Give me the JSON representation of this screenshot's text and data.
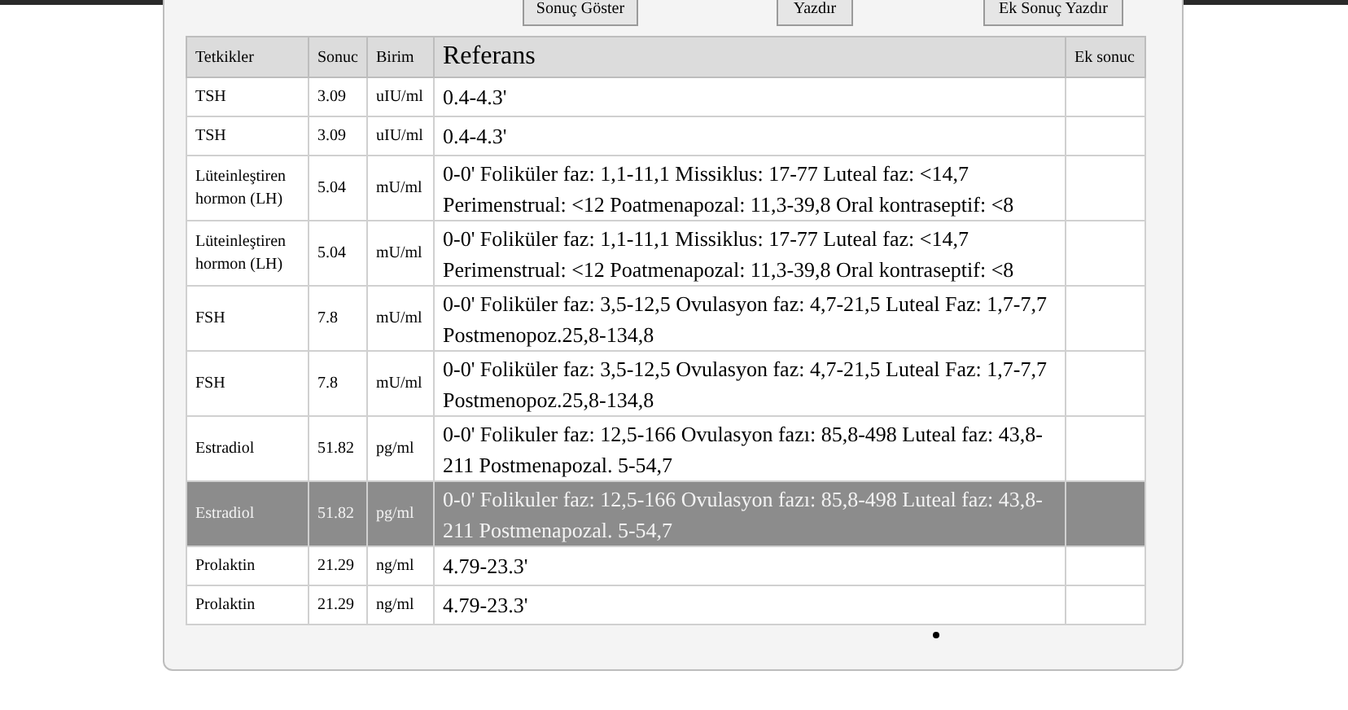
{
  "buttons": [
    "Sonuç Göster",
    "Yazdır",
    "Ek Sonuç Yazdır"
  ],
  "table": {
    "columns": [
      "Tetkikler",
      "Sonuc",
      "Birim",
      "Referans",
      "Ek sonuc"
    ],
    "rows": [
      {
        "test": "TSH",
        "result": "3.09",
        "unit": "uIU/ml",
        "reference": "0.4-4.3'",
        "selected": false
      },
      {
        "test": "TSH",
        "result": "3.09",
        "unit": "uIU/ml",
        "reference": "0.4-4.3'",
        "selected": false
      },
      {
        "test": "Lüteinleştiren hormon (LH)",
        "result": "5.04",
        "unit": "mU/ml",
        "reference": "0-0' Foliküler faz: 1,1-11,1 Missiklus: 17-77 Luteal faz: <14,7 Perimenstrual: <12 Poatmenapozal: 11,3-39,8 Oral kontraseptif: <8",
        "selected": false
      },
      {
        "test": "Lüteinleştiren hormon (LH)",
        "result": "5.04",
        "unit": "mU/ml",
        "reference": "0-0' Foliküler faz: 1,1-11,1 Missiklus: 17-77 Luteal faz: <14,7 Perimenstrual: <12 Poatmenapozal: 11,3-39,8 Oral kontraseptif: <8",
        "selected": false
      },
      {
        "test": "FSH",
        "result": "7.8",
        "unit": "mU/ml",
        "reference": "0-0' Foliküler faz: 3,5-12,5 Ovulasyon faz: 4,7-21,5 Luteal Faz: 1,7-7,7 Postmenopoz.25,8-134,8",
        "selected": false
      },
      {
        "test": "FSH",
        "result": "7.8",
        "unit": "mU/ml",
        "reference": "0-0' Foliküler faz: 3,5-12,5 Ovulasyon faz: 4,7-21,5 Luteal Faz: 1,7-7,7 Postmenopoz.25,8-134,8",
        "selected": false
      },
      {
        "test": "Estradiol",
        "result": "51.82",
        "unit": "pg/ml",
        "reference": "0-0' Folikuler faz: 12,5-166 Ovulasyon fazı: 85,8-498 Luteal faz: 43,8-211 Postmenapozal. 5-54,7",
        "selected": false
      },
      {
        "test": "Estradiol",
        "result": "51.82",
        "unit": "pg/ml",
        "reference": "0-0' Folikuler faz: 12,5-166 Ovulasyon fazı: 85,8-498 Luteal faz: 43,8-211 Postmenapozal. 5-54,7",
        "selected": true
      },
      {
        "test": "Prolaktin",
        "result": "21.29",
        "unit": "ng/ml",
        "reference": "4.79-23.3'",
        "selected": false
      },
      {
        "test": "Prolaktin",
        "result": "21.29",
        "unit": "ng/ml",
        "reference": "4.79-23.3'",
        "selected": false
      }
    ]
  }
}
